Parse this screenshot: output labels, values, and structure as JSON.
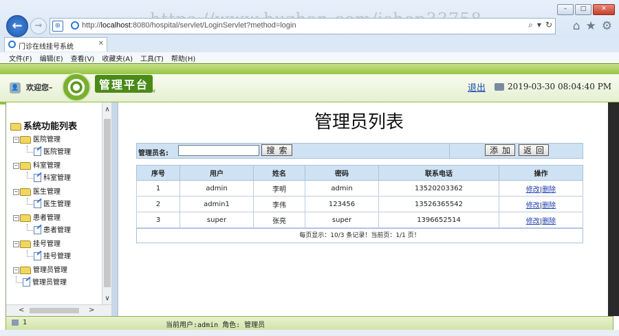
{
  "browser": {
    "url_prefix": "http://",
    "url_host": "localhost",
    "url_rest": ":8080/hospital/servlet/LoginServlet?method=login",
    "watermark": "https://www.huzhan.com/ishop33758",
    "tab_title": "门诊在线挂号系统",
    "menu": [
      "文件(F)",
      "编辑(E)",
      "查看(V)",
      "收藏夹(A)",
      "工具(T)",
      "帮助(H)"
    ],
    "window_controls": [
      "–",
      "□",
      "✕"
    ]
  },
  "header": {
    "welcome": "欢迎您–",
    "logo_title": "管理平台",
    "logo_sub": "PLATFORM SYSTEM",
    "logout": "退出",
    "datetime": "2019-03-30 08:04:40 PM"
  },
  "sidebar": {
    "root": "系统功能列表",
    "groups": [
      {
        "label": "医院管理",
        "child": "医院管理"
      },
      {
        "label": "科室管理",
        "child": "科室管理"
      },
      {
        "label": "医生管理",
        "child": "医生管理"
      },
      {
        "label": "患者管理",
        "child": "患者管理"
      },
      {
        "label": "挂号管理",
        "child": "挂号管理"
      },
      {
        "label": "管理员管理",
        "child": "管理员管理"
      }
    ]
  },
  "main": {
    "title": "管理员列表",
    "search_label": "管理员名:",
    "search_value": "",
    "search_button": "搜索",
    "add_button": "添加",
    "back_button": "返回",
    "columns": [
      "序号",
      "用户",
      "姓名",
      "密码",
      "联系电话",
      "操作"
    ],
    "rows": [
      {
        "no": "1",
        "user": "admin",
        "name": "李明",
        "password": "admin",
        "phone": "13520203362",
        "edit": "修改",
        "delete": "删除"
      },
      {
        "no": "2",
        "user": "admin1",
        "name": "李伟",
        "password": "123456",
        "phone": "13526365542",
        "edit": "修改",
        "delete": "删除"
      },
      {
        "no": "3",
        "user": "super",
        "name": "张亮",
        "password": "super",
        "phone": "1396652514",
        "edit": "修改",
        "delete": "删除"
      }
    ],
    "pager": "每页显示：10/3 条记录！当前页：1/1 页！"
  },
  "status": {
    "count": "1",
    "user_info": "当前用户:admin  角色: 管理员"
  },
  "colors": {
    "header_green": "#8fc23c",
    "table_header_blue": "#cfe2f4",
    "link_blue": "#1a3ab0"
  }
}
